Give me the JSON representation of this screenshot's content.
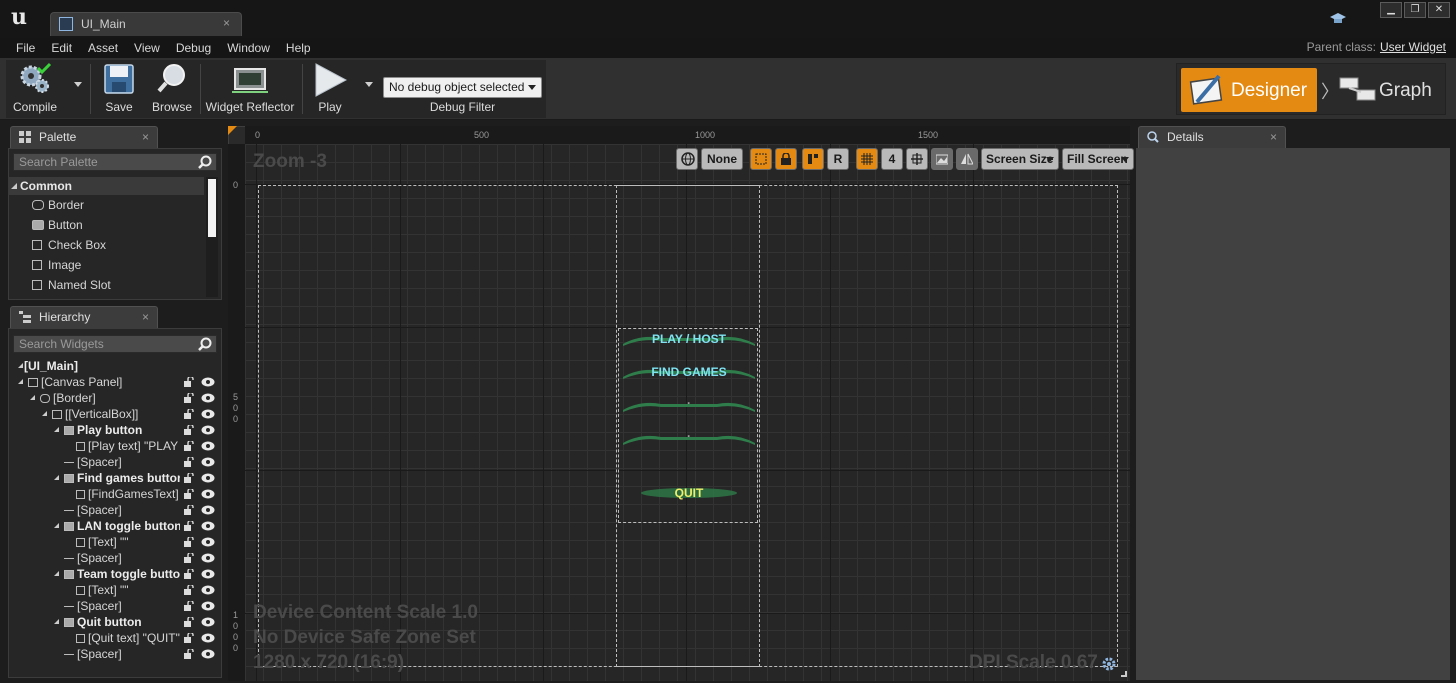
{
  "window": {
    "tab_title": "UI_Main",
    "tab_close": "×",
    "controls": [
      "▁",
      "❐",
      "✕"
    ]
  },
  "menu": {
    "items": [
      "File",
      "Edit",
      "Asset",
      "View",
      "Debug",
      "Window",
      "Help"
    ],
    "parent_class_label": "Parent class:",
    "parent_class_value": "User Widget"
  },
  "toolbar": {
    "compile": "Compile",
    "save": "Save",
    "browse": "Browse",
    "widget_reflector": "Widget Reflector",
    "play": "Play",
    "debug_object": "No debug object selected",
    "debug_filter": "Debug Filter"
  },
  "modes": {
    "designer": "Designer",
    "chevron": "〉",
    "graph": "Graph"
  },
  "palette": {
    "tab": "Palette",
    "close": "×",
    "search_placeholder": "Search Palette",
    "category": "Common",
    "items": [
      "Border",
      "Button",
      "Check Box",
      "Image",
      "Named Slot"
    ]
  },
  "hierarchy": {
    "tab": "Hierarchy",
    "close": "×",
    "search_placeholder": "Search Widgets",
    "rows": [
      {
        "label": "[UI_Main]",
        "bold": true
      },
      {
        "label": "[Canvas Panel]",
        "bold": false
      },
      {
        "label": "[Border]",
        "bold": false
      },
      {
        "label": "[[VerticalBox]]",
        "bold": false
      },
      {
        "label": "Play button",
        "bold": true
      },
      {
        "label": "[Play text] \"PLAY",
        "bold": false
      },
      {
        "label": "[Spacer]",
        "bold": false
      },
      {
        "label": "Find games button",
        "bold": true
      },
      {
        "label": "[FindGamesText]",
        "bold": false
      },
      {
        "label": "[Spacer]",
        "bold": false
      },
      {
        "label": "LAN toggle button",
        "bold": true
      },
      {
        "label": "[Text] \"\"",
        "bold": false
      },
      {
        "label": "[Spacer]",
        "bold": false
      },
      {
        "label": "Team toggle button",
        "bold": true
      },
      {
        "label": "[Text] \"\"",
        "bold": false
      },
      {
        "label": "[Spacer]",
        "bold": false
      },
      {
        "label": "Quit button",
        "bold": true
      },
      {
        "label": "[Quit text] \"QUIT\"",
        "bold": false
      },
      {
        "label": "[Spacer]",
        "bold": false
      }
    ]
  },
  "viewport": {
    "zoom": "Zoom -3",
    "ruler_top": [
      "0",
      "500",
      "1000",
      "1500"
    ],
    "ruler_left_0": "0",
    "ruler_left_500": [
      "5",
      "0",
      "0"
    ],
    "ruler_left_1000": [
      "1",
      "0",
      "0",
      "0"
    ],
    "toolbar": {
      "none_label": "None",
      "r_label": "R",
      "grid_num": "4",
      "screen_size": "Screen Size",
      "fill_screen": "Fill Screen"
    },
    "device_scale": "Device Content Scale 1.0",
    "safe_zone": "No Device Safe Zone Set",
    "resolution": "1280 x 720 (16:9)",
    "dpi_scale": "DPI Scale 0.67",
    "buttons": [
      {
        "text": "PLAY / HOST",
        "color": "#7fe3f2"
      },
      {
        "text": "FIND GAMES",
        "color": "#7fe3f2"
      },
      {
        "text": "·",
        "color": "#9a9a9a"
      },
      {
        "text": "·",
        "color": "#9a9a9a"
      },
      {
        "text": "QUIT",
        "color": "#f1f06a"
      }
    ]
  },
  "details": {
    "tab": "Details",
    "close": "×"
  },
  "colors": {
    "accent": "#e48a12",
    "button_green": "#2e7d4a"
  }
}
